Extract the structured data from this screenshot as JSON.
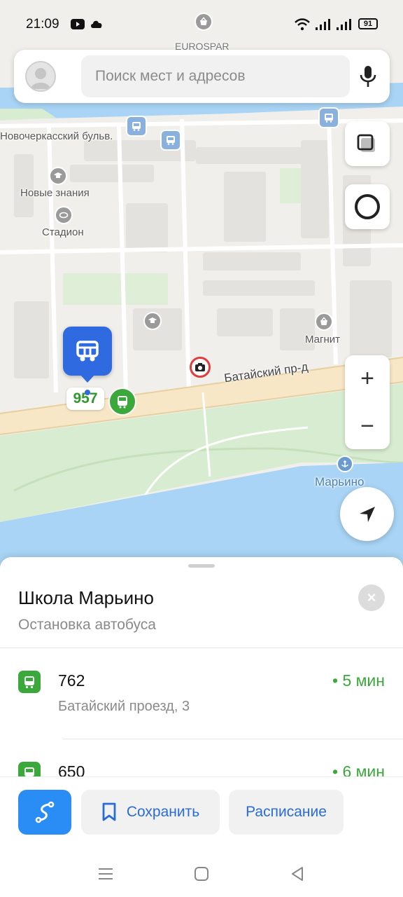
{
  "status_bar": {
    "time": "21:09",
    "battery": "91"
  },
  "search": {
    "placeholder": "Поиск мест и адресов"
  },
  "map": {
    "labels": {
      "eurospar": "EUROSPAR",
      "novocherkassky": "Новочеркасский бульв.",
      "novye_znaniya": "Новые знания",
      "stadion": "Стадион",
      "magnit": "Магнит",
      "bataisky": "Батайский пр-д",
      "marino": "Марьино",
      "route_badge": "957"
    }
  },
  "sheet": {
    "title": "Школа Марьино",
    "subtitle": "Остановка автобуса",
    "close_symbol": "×",
    "routes": [
      {
        "number": "762",
        "address": "Батайский проезд, 3",
        "eta": "• 5 мин"
      },
      {
        "number": "650",
        "address": "",
        "eta": "• 6 мин"
      }
    ]
  },
  "actions": {
    "save": "Сохранить",
    "schedule": "Расписание"
  },
  "zoom": {
    "plus": "+",
    "minus": "−"
  },
  "colors": {
    "accent_blue": "#2a8cf5",
    "pin_blue": "#2f6ae0",
    "eta_green": "#3aa83a",
    "water": "#a9d4f5",
    "park": "#d7ecd0"
  }
}
